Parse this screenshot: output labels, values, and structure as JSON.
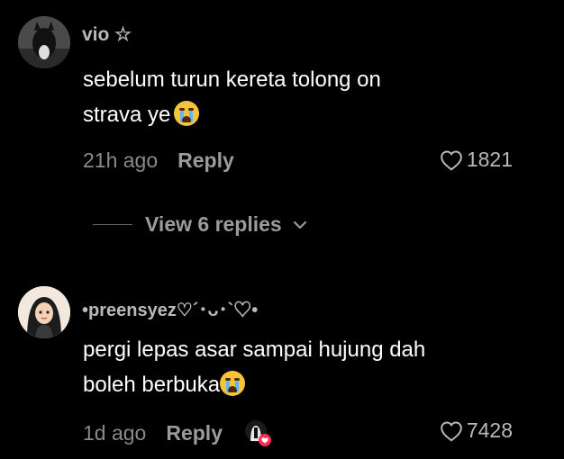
{
  "comments": [
    {
      "username": "vio ☆",
      "text_line1": "sebelum turun kereta tolong on",
      "text_line2": "strava ye",
      "time": "21h ago",
      "reply_label": "Reply",
      "likes": "1821",
      "avatar_icon": "cat-avatar"
    },
    {
      "username": "•preensyez♡´･ᴗ･`♡•",
      "text_line1": "pergi lepas asar sampai hujung dah",
      "text_line2": "boleh berbuka",
      "time": "1d ago",
      "reply_label": "Reply",
      "likes": "7428",
      "avatar_icon": "hijab-girl-avatar"
    }
  ],
  "view_replies_label": "View 6 replies",
  "colors": {
    "background": "#000000",
    "muted": "#8a8a8a",
    "heart_badge": "#fe2c55"
  }
}
